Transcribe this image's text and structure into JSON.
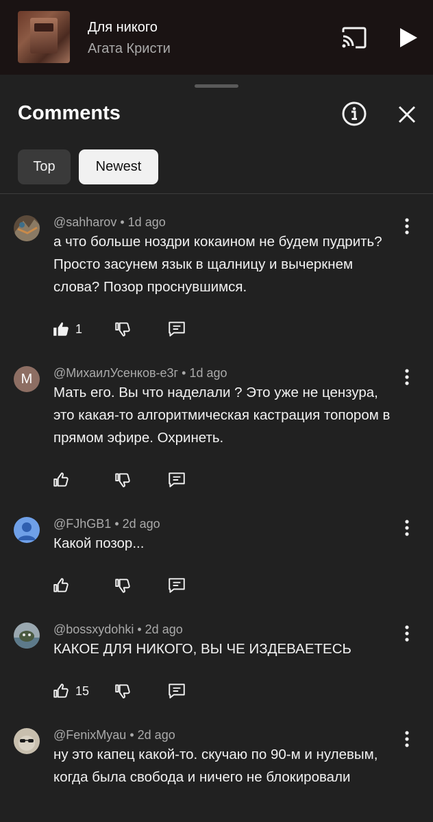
{
  "player": {
    "song_title": "Для никого",
    "artist": "Агата Кристи",
    "cast_icon": "cast-icon",
    "play_icon": "play-icon"
  },
  "comments_panel": {
    "title": "Comments",
    "info_icon": "info-icon",
    "close_icon": "close-icon",
    "chips": [
      {
        "label": "Top",
        "selected": false
      },
      {
        "label": "Newest",
        "selected": true
      }
    ]
  },
  "comments": [
    {
      "author": "@sahharov",
      "age": "1d ago",
      "text": "а что больше ноздри кокаином не будем пудрить? Просто засунем язык в щалницу и вычеркнем слова? Позор проснувшимся.",
      "likes": "1",
      "liked": true
    },
    {
      "author": "@МихаилУсенков-е3г",
      "age": "1d ago",
      "avatar_letter": "М",
      "text": "Мать его. Вы что наделали ? Это уже не цензура, это какая-то алгоритмическая кастрация топором в прямом эфире. Охринеть.",
      "likes": "",
      "liked": false
    },
    {
      "author": "@FJhGB1",
      "age": "2d ago",
      "text": "Какой позор...",
      "likes": "",
      "liked": false
    },
    {
      "author": "@bossxydohki",
      "age": "2d ago",
      "text": "КАКОЕ ДЛЯ НИКОГО, ВЫ ЧЕ ИЗДЕВАЕТЕСЬ",
      "likes": "15",
      "liked": false
    },
    {
      "author": "@FenixMyau",
      "age": "2d ago",
      "text": "ну это капец какой-то. скучаю по 90-м и нулевым, когда была свобода и ничего не блокировали",
      "likes": "",
      "liked": false
    }
  ],
  "separator": "•",
  "colors": {
    "background": "#212121",
    "player_background": "#1a1313",
    "text_primary": "#f1f1f1",
    "text_secondary": "#aaaaaa",
    "chip_selected": "#f1f1f1",
    "chip_unselected": "#3a3a3a",
    "avatar_letter_bg": "#8d6e63",
    "avatar_default_bg": "#6fa0e8"
  }
}
